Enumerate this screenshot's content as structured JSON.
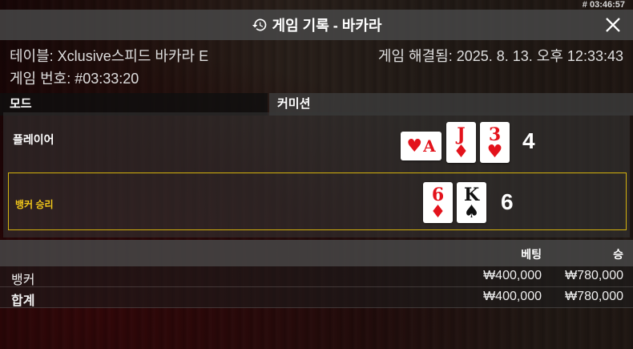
{
  "clock": "# 03:46:57",
  "header": {
    "title": "게임 기록 - 바카라",
    "icon": "history-icon",
    "close_icon": "close-icon"
  },
  "info": {
    "table": "테이블: Xclusive스피드 바카라 E",
    "resolved": "게임 해결됨: 2025. 8. 13. 오후 12:33:43",
    "game_number": "게임 번호: #03:33:20"
  },
  "columns": {
    "mode": "모드",
    "commission": "커미션"
  },
  "player": {
    "label": "플레이어",
    "score": "4",
    "cards": [
      {
        "rank": "A",
        "suit": "♥",
        "color": "red",
        "sideways": true
      },
      {
        "rank": "J",
        "suit": "♦",
        "color": "red",
        "sideways": false
      },
      {
        "rank": "3",
        "suit": "♥",
        "color": "red",
        "sideways": false
      }
    ]
  },
  "banker": {
    "label": "뱅커 승리",
    "score": "6",
    "cards": [
      {
        "rank": "6",
        "suit": "♦",
        "color": "red",
        "sideways": false
      },
      {
        "rank": "K",
        "suit": "♠",
        "color": "black",
        "sideways": false
      }
    ]
  },
  "bets": {
    "header_bet": "베팅",
    "header_win": "승",
    "rows": [
      {
        "label": "뱅커",
        "amount": "₩400,000",
        "win": "₩780,000"
      },
      {
        "label": "합계",
        "amount": "₩400,000",
        "win": "₩780,000"
      }
    ]
  },
  "colors": {
    "accent": "#f2c81a",
    "card_red": "#e3121b",
    "header_bg": "#464646"
  }
}
